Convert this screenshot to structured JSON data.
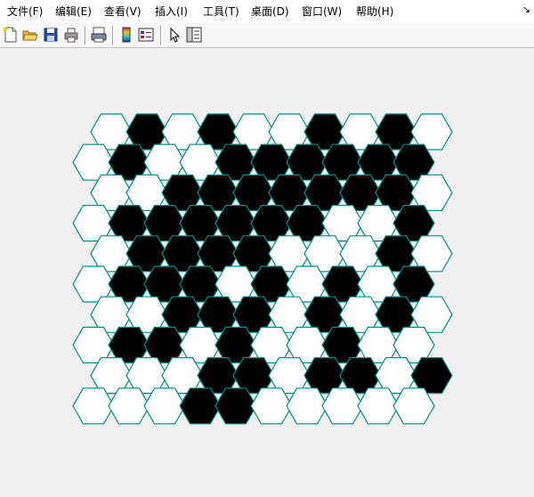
{
  "menu": {
    "items": [
      {
        "label": "文件(F)"
      },
      {
        "label": "编辑(E)"
      },
      {
        "label": "查看(V)"
      },
      {
        "label": "插入(I)"
      },
      {
        "label": "工具(T)"
      },
      {
        "label": "桌面(D)"
      },
      {
        "label": "窗口(W)"
      },
      {
        "label": "帮助(H)"
      }
    ],
    "corner_icon": "dock-arrow-icon"
  },
  "toolbar": {
    "buttons": [
      {
        "icon": "new-file-icon"
      },
      {
        "icon": "open-folder-icon"
      },
      {
        "icon": "save-icon"
      },
      {
        "icon": "print-icon"
      },
      {
        "icon": "print-preview-icon"
      },
      {
        "icon": "colorbar-icon"
      },
      {
        "icon": "legend-icon"
      },
      {
        "icon": "pointer-icon"
      },
      {
        "icon": "property-editor-icon"
      }
    ]
  },
  "grid": {
    "rows": [
      "0101001010",
      "0100111111",
      "0011111110",
      "0111111001",
      "0111100010",
      "0111010101",
      "0011101010",
      "0110100100",
      "0001101101",
      "0001100000"
    ],
    "colors": {
      "filled": "#000000",
      "empty": "#ffffff",
      "edge": "#008c8c"
    }
  }
}
